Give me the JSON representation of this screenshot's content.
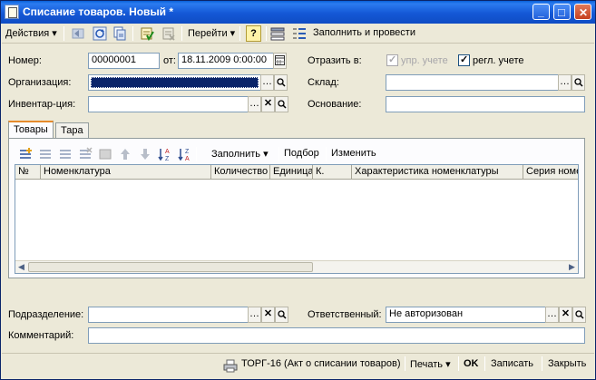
{
  "window": {
    "title": "Списание товаров. Новый *",
    "buttons": {
      "minimize": "_",
      "maximize": "□",
      "close": "✕"
    }
  },
  "toolbar": {
    "actions": "Действия",
    "goto": "Перейти",
    "help": "?",
    "fill_and_post": "Заполнить и провести"
  },
  "form": {
    "number_label": "Номер:",
    "number_value": "00000001",
    "date_label": "от:",
    "date_value": "18.11.2009  0:00:00",
    "reflect_label": "Отразить в:",
    "upr_label": "упр. учете",
    "upr_checked": true,
    "regl_label": "регл. учете",
    "regl_checked": true,
    "org_label": "Организация:",
    "org_value": "",
    "warehouse_label": "Склад:",
    "warehouse_value": "",
    "inventory_label": "Инвентар-ция:",
    "inventory_value": "",
    "basis_label": "Основание:",
    "basis_value": ""
  },
  "tabs": [
    {
      "label": "Товары",
      "active": true
    },
    {
      "label": "Тара",
      "active": false
    }
  ],
  "grid": {
    "toolbar": {
      "fill": "Заполнить",
      "select": "Подбор",
      "change": "Изменить"
    },
    "columns": [
      "№",
      "Номенклатура",
      "Количество",
      "Единица",
      "К.",
      "Характеристика номенклатуры",
      "Серия номе"
    ]
  },
  "footer": {
    "department_label": "Подразделение:",
    "department_value": "",
    "responsible_label": "Ответственный:",
    "responsible_value": "Не авторизован",
    "comment_label": "Комментарий:",
    "comment_value": ""
  },
  "bottom": {
    "print_form": "ТОРГ-16 (Акт о списании товаров)",
    "print": "Печать",
    "ok": "OK",
    "save": "Записать",
    "close": "Закрыть"
  },
  "colors": {
    "title_bar": "#0F4CC4",
    "selection": "#0A246A",
    "window_bg": "#ECE9D8"
  }
}
